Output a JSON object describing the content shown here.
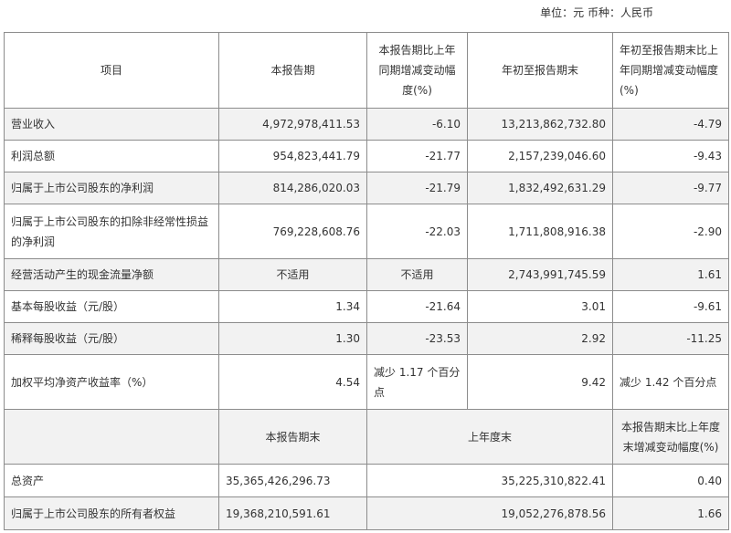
{
  "unit_note": "单位：元 币种：人民币",
  "header": {
    "item": "项目",
    "current": "本报告期",
    "current_yoy": "本报告期比上年同期增减变动幅度(%)",
    "ytd": "年初至报告期末",
    "ytd_yoy": "年初至报告期末比上年同期增减变动幅度(%)"
  },
  "rows": [
    {
      "label": "营业收入",
      "current": "4,972,978,411.53",
      "current_yoy": "-6.10",
      "ytd": "13,213,862,732.80",
      "ytd_yoy": "-4.79"
    },
    {
      "label": "利润总额",
      "current": "954,823,441.79",
      "current_yoy": "-21.77",
      "ytd": "2,157,239,046.60",
      "ytd_yoy": "-9.43"
    },
    {
      "label": "归属于上市公司股东的净利润",
      "current": "814,286,020.03",
      "current_yoy": "-21.79",
      "ytd": "1,832,492,631.29",
      "ytd_yoy": "-9.77"
    },
    {
      "label": "归属于上市公司股东的扣除非经常性损益的净利润",
      "current": "769,228,608.76",
      "current_yoy": "-22.03",
      "ytd": "1,711,808,916.38",
      "ytd_yoy": "-2.90"
    },
    {
      "label": "经营活动产生的现金流量净额",
      "current": "不适用",
      "current_yoy": "不适用",
      "ytd": "2,743,991,745.59",
      "ytd_yoy": "1.61"
    },
    {
      "label": "基本每股收益（元/股）",
      "current": "1.34",
      "current_yoy": "-21.64",
      "ytd": "3.01",
      "ytd_yoy": "-9.61"
    },
    {
      "label": "稀释每股收益（元/股）",
      "current": "1.30",
      "current_yoy": "-23.53",
      "ytd": "2.92",
      "ytd_yoy": "-11.25"
    },
    {
      "label": "加权平均净资产收益率（%）",
      "current": "4.54",
      "current_yoy": "减少 1.17 个百分点",
      "ytd": "9.42",
      "ytd_yoy": "减少 1.42 个百分点"
    }
  ],
  "header2": {
    "period_end": "本报告期末",
    "last_year_end": "上年度末",
    "change": "本报告期末比上年度末增减变动幅度(%)"
  },
  "rows2": [
    {
      "label": "总资产",
      "period_end": "35,365,426,296.73",
      "last_year_end": "35,225,310,822.41",
      "change": "0.40"
    },
    {
      "label": "归属于上市公司股东的所有者权益",
      "period_end": "19,368,210,591.61",
      "last_year_end": "19,052,276,878.56",
      "change": "1.66"
    }
  ]
}
